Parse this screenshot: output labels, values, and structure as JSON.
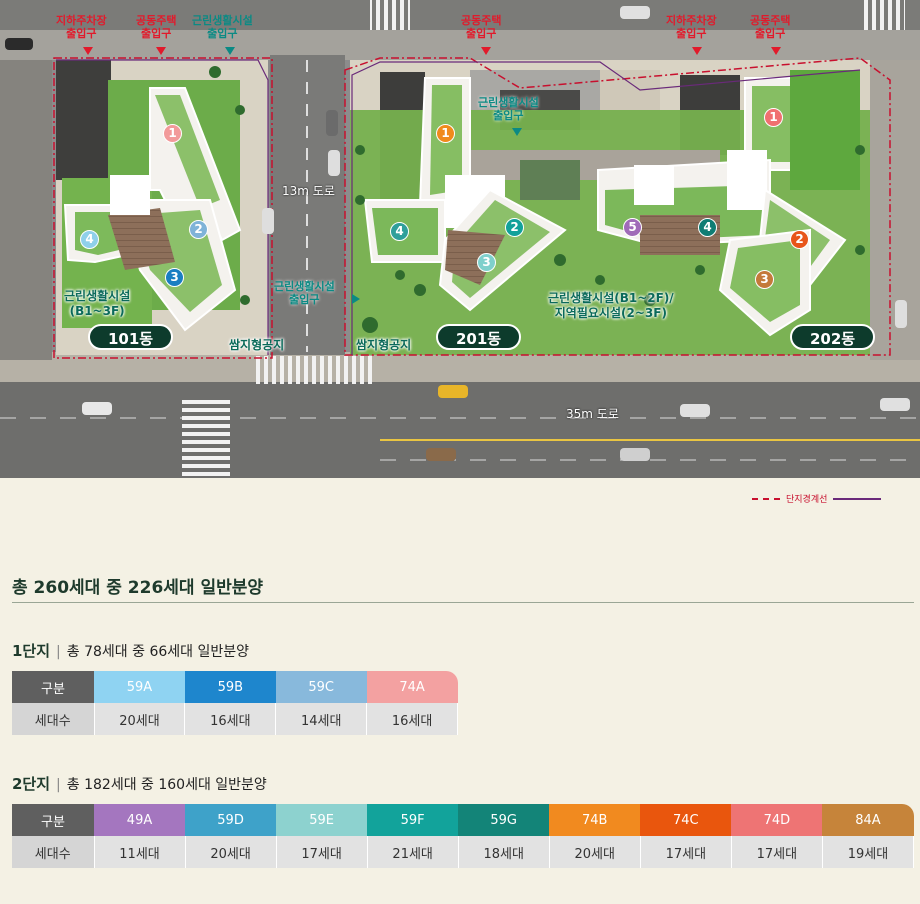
{
  "map": {
    "top_labels": [
      {
        "text": "지하주차장\n출입구",
        "color": "red"
      },
      {
        "text": "공동주택\n출입구",
        "color": "red"
      },
      {
        "text": "근린생활시설\n출입구",
        "color": "teal"
      },
      {
        "text": "공동주택\n출입구",
        "color": "red"
      },
      {
        "text": "지하주차장\n출입구",
        "color": "red"
      },
      {
        "text": "공동주택\n출입구",
        "color": "red"
      }
    ],
    "inner_label": "근린생활시설\n출입구",
    "side_label": "근린생활시설\n출입구",
    "road_13": "13m 도로",
    "road_35": "35m 도로",
    "shop_101": "근린생활시설\n(B1~3F)",
    "shop_201": "근린생활시설(B1~2F)/\n지역필요시설(2~3F)",
    "pocket_1": "쌈지형공지",
    "pocket_2": "쌈지형공지",
    "dong_101": "101동",
    "dong_201": "201동",
    "dong_202": "202동",
    "unit_markers": [
      {
        "n": "1",
        "color": "#f29a9a"
      },
      {
        "n": "2",
        "color": "#7fb3d8"
      },
      {
        "n": "3",
        "color": "#1a7ec2"
      },
      {
        "n": "4",
        "color": "#8fd0ea"
      },
      {
        "n": "1",
        "color": "#f08a1c"
      },
      {
        "n": "2",
        "color": "#12a19a"
      },
      {
        "n": "3",
        "color": "#7fd0cc"
      },
      {
        "n": "4",
        "color": "#2f9f9a"
      },
      {
        "n": "5",
        "color": "#a06bb8"
      },
      {
        "n": "4",
        "color": "#0f7d74"
      },
      {
        "n": "1",
        "color": "#f07070"
      },
      {
        "n": "2",
        "color": "#e8551a"
      },
      {
        "n": "3",
        "color": "#c47a3a"
      }
    ]
  },
  "legend": {
    "label": "단지경계선"
  },
  "summary": {
    "title": "총 260세대 중 226세대 일반분양"
  },
  "complex1": {
    "name": "1단지",
    "desc": "총 78세대 중 66세대 일반분양",
    "header_label": "구분",
    "row_label": "세대수",
    "types": [
      {
        "type": "59A",
        "count": "20세대",
        "color": "#8fd3f2"
      },
      {
        "type": "59B",
        "count": "16세대",
        "color": "#1e86cd"
      },
      {
        "type": "59C",
        "count": "14세대",
        "color": "#88b9dc"
      },
      {
        "type": "74A",
        "count": "16세대",
        "color": "#f3a1a1"
      }
    ]
  },
  "complex2": {
    "name": "2단지",
    "desc": "총 182세대 중 160세대 일반분양",
    "header_label": "구분",
    "row_label": "세대수",
    "types": [
      {
        "type": "49A",
        "count": "11세대",
        "color": "#a476bf"
      },
      {
        "type": "59D",
        "count": "20세대",
        "color": "#3ea2c9"
      },
      {
        "type": "59E",
        "count": "17세대",
        "color": "#8dd2cf"
      },
      {
        "type": "59F",
        "count": "21세대",
        "color": "#12a39b"
      },
      {
        "type": "59G",
        "count": "18세대",
        "color": "#138478"
      },
      {
        "type": "74B",
        "count": "20세대",
        "color": "#f18a1f"
      },
      {
        "type": "74C",
        "count": "17세대",
        "color": "#e9560d"
      },
      {
        "type": "74D",
        "count": "17세대",
        "color": "#ee7474"
      },
      {
        "type": "84A",
        "count": "19세대",
        "color": "#c6843a"
      }
    ]
  }
}
